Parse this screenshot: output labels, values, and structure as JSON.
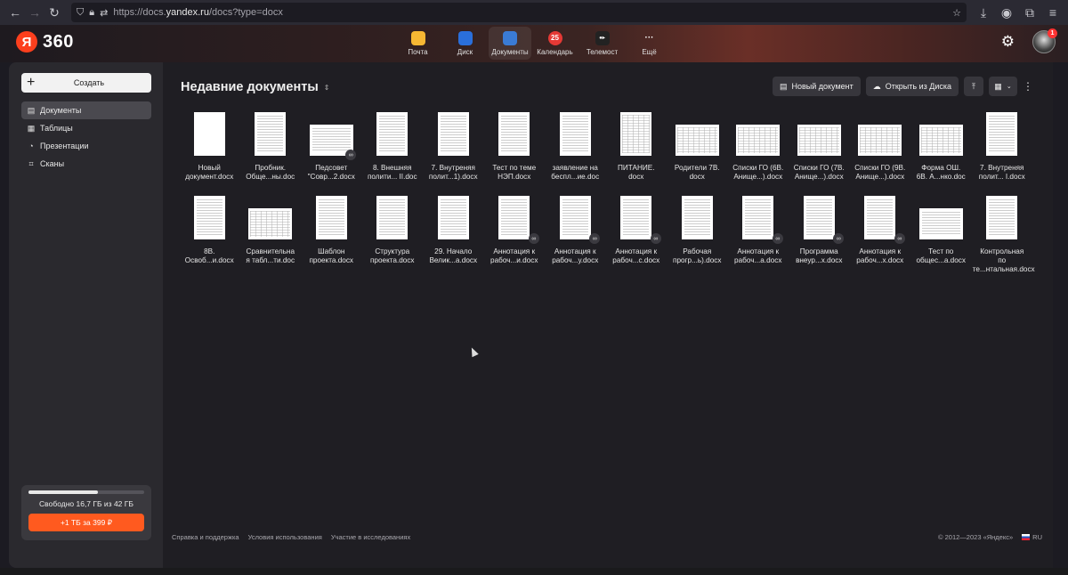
{
  "browser": {
    "url_prefix": "https://docs.",
    "url_host": "yandex.ru",
    "url_path": "/docs?type=docx"
  },
  "header": {
    "brand_ya": "Я",
    "brand_360": "360",
    "services": [
      {
        "label": "Почта",
        "icon": "mail-icon",
        "color": "#f7b733"
      },
      {
        "label": "Диск",
        "icon": "disk-icon",
        "color": "#2a6fdb"
      },
      {
        "label": "Документы",
        "icon": "docs-icon",
        "color": "#3a7bd5",
        "active": true
      },
      {
        "label": "Календарь",
        "icon": "calendar-icon",
        "color": "#e53935",
        "badge": "25"
      },
      {
        "label": "Телемост",
        "icon": "telemost-icon",
        "color": "#222"
      },
      {
        "label": "Ещё",
        "icon": "more-icon",
        "color": "transparent"
      }
    ],
    "notifications_count": "1"
  },
  "sidebar": {
    "create_label": "Создать",
    "items": [
      {
        "label": "Документы",
        "icon": "document-icon",
        "active": true
      },
      {
        "label": "Таблицы",
        "icon": "table-icon"
      },
      {
        "label": "Презентации",
        "icon": "presentation-icon"
      },
      {
        "label": "Сканы",
        "icon": "scan-icon"
      }
    ],
    "storage": {
      "used_fraction": 0.6,
      "text": "Свободно 16,7 ГБ из 42 ГБ",
      "upgrade_label": "+1 ТБ за 399 ₽"
    }
  },
  "main": {
    "title": "Недавние документы",
    "toolbar": {
      "new_doc_label": "Новый документ",
      "open_disk_label": "Открыть из Диска"
    },
    "documents": [
      {
        "name": "Новый\nдокумент.docx",
        "orientation": "portrait",
        "blank": true
      },
      {
        "name": "Пробник.\nОбще...ны.doc",
        "orientation": "portrait"
      },
      {
        "name": "Педсовет\n\"Совр...2.docx",
        "orientation": "landscape",
        "shared": true
      },
      {
        "name": "8. Внешняя\nполити... II.doc",
        "orientation": "portrait"
      },
      {
        "name": "7. Внутреняя\nполит...1).docx",
        "orientation": "portrait"
      },
      {
        "name": "Тест по теме\nНЭП.docx",
        "orientation": "portrait"
      },
      {
        "name": "заявление на\nбеспл...ие.doc",
        "orientation": "portrait"
      },
      {
        "name": "ПИТАНИЕ.\ndocx",
        "orientation": "portrait",
        "table": true
      },
      {
        "name": "Родители 7В.\ndocx",
        "orientation": "landscape",
        "table": true
      },
      {
        "name": "Списки ГО (6В.\nАнище...).docx",
        "orientation": "landscape",
        "table": true
      },
      {
        "name": "Списки ГО (7В.\nАнище...).docx",
        "orientation": "landscape",
        "table": true
      },
      {
        "name": "Списки ГО (9В.\nАнище...).docx",
        "orientation": "landscape",
        "table": true
      },
      {
        "name": "Форма ОШ.\n6В. А...нко.doc",
        "orientation": "landscape",
        "table": true
      },
      {
        "name": "7. Внутреняя\nполит... I.docx",
        "orientation": "portrait"
      },
      {
        "name": "8В.\nОсвоб...и.docx",
        "orientation": "portrait"
      },
      {
        "name": "Сравнительна\nя табл...ти.doc",
        "orientation": "landscape",
        "table": true
      },
      {
        "name": "Шаблон\nпроекта.docx",
        "orientation": "portrait"
      },
      {
        "name": "Структура\nпроекта.docx",
        "orientation": "portrait"
      },
      {
        "name": "29. Начало\nВелик...а.docx",
        "orientation": "portrait"
      },
      {
        "name": "Аннотация к\nрабоч...и.docx",
        "orientation": "portrait",
        "shared": true
      },
      {
        "name": "Аннотация к\nрабоч...у.docx",
        "orientation": "portrait",
        "shared": true
      },
      {
        "name": "Аннотация к\nрабоч...с.docx",
        "orientation": "portrait",
        "shared": true
      },
      {
        "name": "Рабочая\nпрогр...ь).docx",
        "orientation": "portrait"
      },
      {
        "name": "Аннотация к\nрабоч...а.docx",
        "orientation": "portrait",
        "shared": true
      },
      {
        "name": "Программа\nвнеур...х.docx",
        "orientation": "portrait",
        "shared": true
      },
      {
        "name": "Аннотация к\nрабоч...х.docx",
        "orientation": "portrait",
        "shared": true
      },
      {
        "name": "Тест по\nобщес...а.docx",
        "orientation": "landscape"
      },
      {
        "name": "Контрольная\nпо те...нтальная.docx",
        "orientation": "portrait"
      }
    ]
  },
  "footer": {
    "links": [
      "Справка и поддержка",
      "Условия использования",
      "Участие в исследованиях"
    ],
    "copyright": "© 2012—2023 «Яндекс»",
    "lang": "RU"
  }
}
